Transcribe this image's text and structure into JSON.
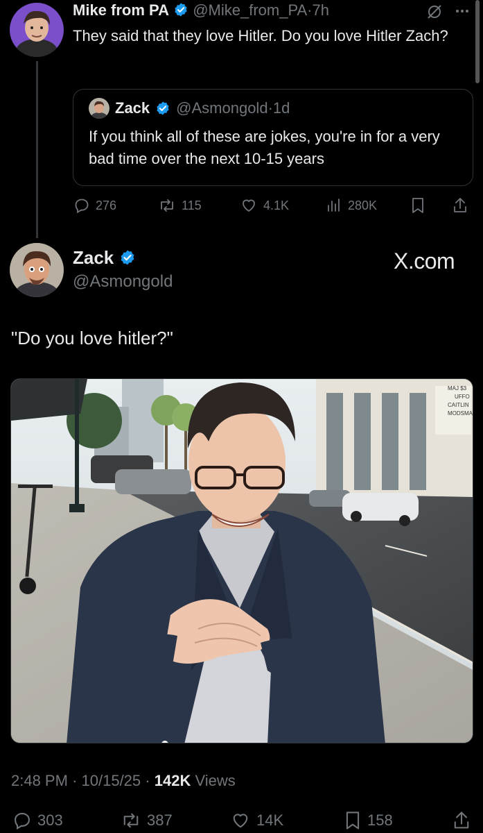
{
  "reply_tweet": {
    "author_name": "Mike from PA",
    "handle": "@Mike_from_PA",
    "separator": "·",
    "time": "7h",
    "text": "They said that they love Hitler. Do you love Hitler Zach?",
    "quoted": {
      "author_name": "Zack",
      "handle": "@Asmongold",
      "separator": "·",
      "time": "1d",
      "text": "If you think all of these are jokes, you're in for a very bad time over the next 10-15 years"
    },
    "stats": {
      "replies": "276",
      "reposts": "115",
      "likes": "4.1K",
      "views": "280K"
    }
  },
  "main_tweet": {
    "author_name": "Zack",
    "handle": "@Asmongold",
    "watermark": "X.com",
    "text": "\"Do you love hitler?\"",
    "image_signs": [
      "MAJ $3",
      "UFFO",
      "CAITLIN",
      "MODSMA"
    ],
    "time": "2:48 PM",
    "date": "10/15/25",
    "views_count": "142K",
    "views_label": "Views",
    "meta_separator": "·",
    "stats": {
      "replies": "303",
      "reposts": "387",
      "likes": "14K",
      "bookmarks": "158"
    }
  },
  "colors": {
    "background": "#000000",
    "text": "#e7e9ea",
    "muted": "#71767b",
    "verified": "#1d9bf0",
    "border": "#2f3336"
  }
}
